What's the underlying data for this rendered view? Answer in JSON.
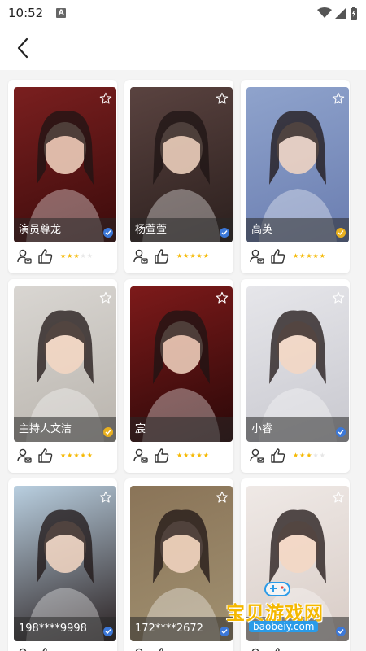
{
  "status_bar": {
    "time": "10:52",
    "a_badge": "A"
  },
  "header": {
    "back_icon": "chevron-left-icon"
  },
  "cards": [
    {
      "name": "演员尊龙",
      "badge": "blue",
      "rating": 3,
      "photo_colors": [
        "#7a1f1f",
        "#3b0b0b"
      ]
    },
    {
      "name": "杨萱萱",
      "badge": "blue",
      "rating": 5,
      "photo_colors": [
        "#5a4340",
        "#2b1f1d"
      ]
    },
    {
      "name": "高英",
      "badge": "gold",
      "rating": 5,
      "photo_colors": [
        "#8fa3cc",
        "#6a7db0"
      ]
    },
    {
      "name": "主持人文洁",
      "badge": "gold",
      "rating": 5,
      "photo_colors": [
        "#d9d6d2",
        "#b9b4ad"
      ]
    },
    {
      "name": "宸",
      "badge": "none",
      "rating": 5,
      "photo_colors": [
        "#7d1a1a",
        "#2a0808"
      ]
    },
    {
      "name": "小睿",
      "badge": "blue",
      "rating": 3,
      "photo_colors": [
        "#e6e6ea",
        "#c8c8cf"
      ]
    },
    {
      "name": "198****9998",
      "badge": "blue",
      "rating": 0,
      "photo_colors": [
        "#b9cfe0",
        "#2a2020"
      ]
    },
    {
      "name": "172****2672",
      "badge": "blue",
      "rating": 0,
      "photo_colors": [
        "#8a7458",
        "#a09070"
      ]
    },
    {
      "name": "",
      "badge": "blue",
      "rating": 0,
      "photo_colors": [
        "#efe9e6",
        "#d8ccc6"
      ]
    }
  ],
  "watermark": {
    "text": "宝贝游戏网",
    "url": "baobeiy.com"
  },
  "colors": {
    "accent_star": "#f5b800",
    "badge_blue": "#3c78d8",
    "badge_gold": "#e8b020"
  }
}
